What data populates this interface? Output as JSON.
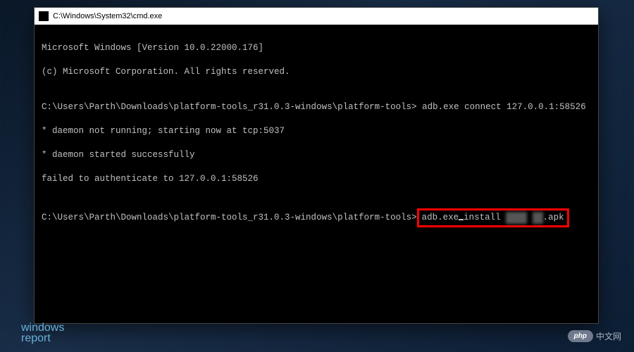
{
  "window": {
    "title": "C:\\Windows\\System32\\cmd.exe"
  },
  "terminal": {
    "line1": "Microsoft Windows [Version 10.0.22000.176]",
    "line2": "(c) Microsoft Corporation. All rights reserved.",
    "blank1": "",
    "prompt1_path": "C:\\Users\\Parth\\Downloads\\platform-tools_r31.0.3-windows\\platform-tools>",
    "prompt1_cmd": " adb.exe connect 127.0.0.1:58526",
    "daemon1": "* daemon not running; starting now at tcp:5037",
    "daemon2": "* daemon started successfully",
    "fail": "failed to authenticate to 127.0.0.1:58526",
    "blank2": "",
    "prompt2_path": "C:\\Users\\Parth\\Downloads\\platform-tools_r31.0.3-windows\\platform-tools>",
    "prompt2_cmd_a": "adb.exe",
    "prompt2_cmd_b": "install ",
    "redacted1": "████",
    "redacted2": "██",
    "prompt2_ext": ".apk"
  },
  "watermarks": {
    "left_line1": "windows",
    "left_line2": "report",
    "right_badge": "php",
    "right_text": "中文网"
  }
}
